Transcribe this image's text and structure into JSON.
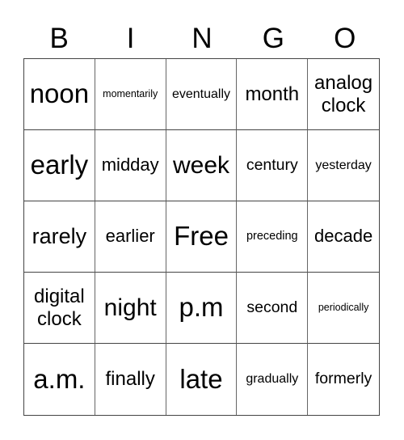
{
  "header": {
    "letters": [
      "B",
      "I",
      "N",
      "G",
      "O"
    ]
  },
  "grid": {
    "rows": [
      [
        "noon",
        "momentarily",
        "eventually",
        "month",
        "analog clock"
      ],
      [
        "early",
        "midday",
        "week",
        "century",
        "yesterday"
      ],
      [
        "rarely",
        "earlier",
        "Free",
        "preceding",
        "decade"
      ],
      [
        "digital clock",
        "night",
        "p.m",
        "second",
        "periodically"
      ],
      [
        "a.m.",
        "finally",
        "late",
        "gradually",
        "formerly"
      ]
    ]
  }
}
